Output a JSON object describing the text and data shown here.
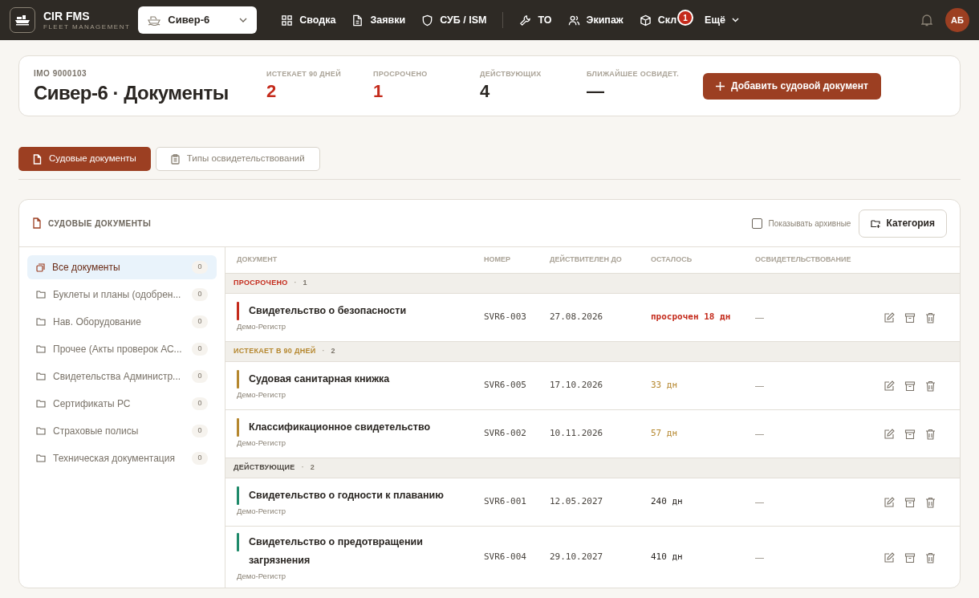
{
  "app": {
    "name": "CIR FMS",
    "subtitle": "FLEET MANAGEMENT"
  },
  "vessel_select": {
    "value": "Сивер-6"
  },
  "nav": [
    {
      "label": "Сводка"
    },
    {
      "label": "Заявки"
    },
    {
      "label": "СУБ / ISM"
    },
    {
      "label": "ТО"
    },
    {
      "label": "Экипаж"
    },
    {
      "label": "Скл",
      "badge": "1"
    },
    {
      "label": "Ещё"
    }
  ],
  "user": {
    "initials": "АБ"
  },
  "summary": {
    "imo": "IMO 9000103",
    "title": "Сивер-6 · Документы",
    "stats": [
      {
        "label": "ИСТЕКАЕТ 90 ДНЕЙ",
        "value": "2",
        "kind": "alert"
      },
      {
        "label": "ПРОСРОЧЕНО",
        "value": "1",
        "kind": "alert"
      },
      {
        "label": "ДЕЙСТВУЮЩИХ",
        "value": "4",
        "kind": "normal"
      },
      {
        "label": "БЛИЖАЙШЕЕ ОСВИДЕТ.",
        "value": "—",
        "kind": "normal"
      }
    ],
    "add_button": "Добавить судовой документ"
  },
  "tabs": [
    {
      "label": "Судовые документы",
      "selected": true
    },
    {
      "label": "Типы освидетельствований",
      "selected": false
    }
  ],
  "panel": {
    "title": "СУДОВЫЕ ДОКУМЕНТЫ",
    "show_archived": {
      "label": "Показывать архивные",
      "checked": false
    },
    "category_button": "Категория"
  },
  "categories": [
    {
      "label": "Все документы",
      "count": "0",
      "selected": true
    },
    {
      "label": "Буклеты и планы (одобрен...",
      "count": "0",
      "selected": false
    },
    {
      "label": "Нав. Оборудование",
      "count": "0",
      "selected": false
    },
    {
      "label": "Прочее (Акты проверок АС...",
      "count": "0",
      "selected": false
    },
    {
      "label": "Свидетельства Администр...",
      "count": "0",
      "selected": false
    },
    {
      "label": "Сертификаты РС",
      "count": "0",
      "selected": false
    },
    {
      "label": "Страховые полисы",
      "count": "0",
      "selected": false
    },
    {
      "label": "Техническая документация",
      "count": "0",
      "selected": false
    }
  ],
  "table": {
    "columns": [
      "ДОКУМЕНТ",
      "НОМЕР",
      "ДЕЙСТВИТЕЛЕН ДО",
      "ОСТАЛОСЬ",
      "ОСВИДЕТЕЛЬСТВОВАНИЕ"
    ],
    "groups": [
      {
        "label": "ПРОСРОЧЕНО",
        "separator": "·",
        "count": "1",
        "kind": "overdue",
        "rows": [
          {
            "title": "Свидетельство о безопасности",
            "registry": "Демо-Регистр",
            "number": "SVR6-003",
            "valid_until": "27.08.2026",
            "remaining": "просрочен 18 дн",
            "survey": "—"
          }
        ]
      },
      {
        "label": "ИСТЕКАЕТ В 90 ДНЕЙ",
        "separator": "·",
        "count": "2",
        "kind": "expiring",
        "rows": [
          {
            "title": "Судовая санитарная книжка",
            "registry": "Демо-Регистр",
            "number": "SVR6-005",
            "valid_until": "17.10.2026",
            "remaining": "33 дн",
            "survey": "—"
          },
          {
            "title": "Классификационное свидетельство",
            "registry": "Демо-Регистр",
            "number": "SVR6-002",
            "valid_until": "10.11.2026",
            "remaining": "57 дн",
            "survey": "—"
          }
        ]
      },
      {
        "label": "ДЕЙСТВУЮЩИЕ",
        "separator": "·",
        "count": "2",
        "kind": "valid",
        "rows": [
          {
            "title": "Свидетельство о годности к плаванию",
            "registry": "Демо-Регистр",
            "number": "SVR6-001",
            "valid_until": "12.05.2027",
            "remaining": "240 дн",
            "survey": "—"
          },
          {
            "title": "Свидетельство о предотвращении загрязнения",
            "registry": "Демо-Регистр",
            "number": "SVR6-004",
            "valid_until": "29.10.2027",
            "remaining": "410 дн",
            "survey": "—"
          }
        ]
      }
    ]
  }
}
